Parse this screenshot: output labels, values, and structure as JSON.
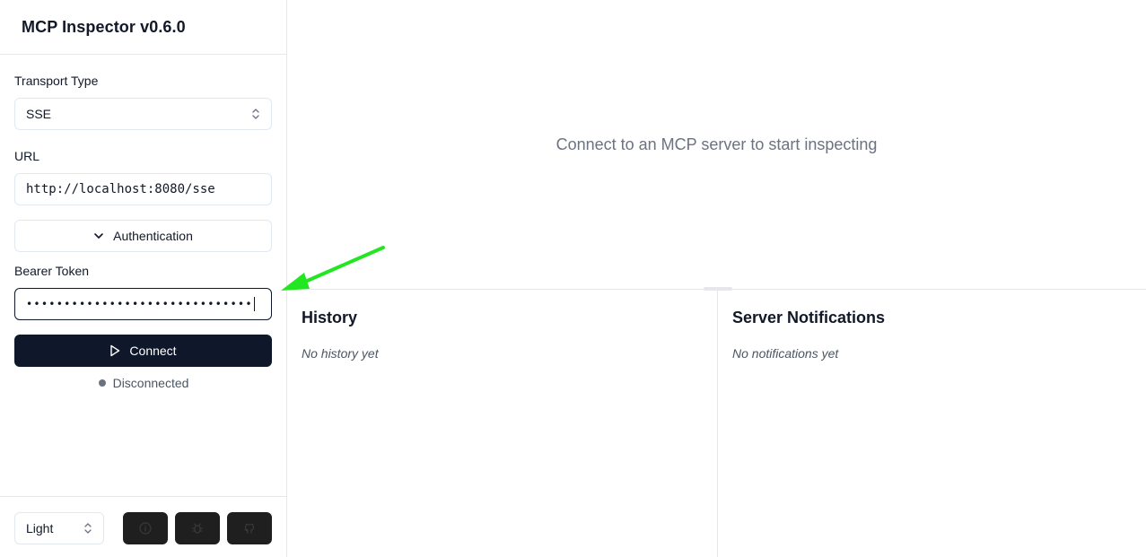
{
  "app": {
    "title": "MCP Inspector v0.6.0"
  },
  "sidebar": {
    "transport": {
      "label": "Transport Type",
      "value": "SSE"
    },
    "url": {
      "label": "URL",
      "value": "http://localhost:8080/sse"
    },
    "auth": {
      "label": "Authentication"
    },
    "bearer": {
      "label": "Bearer Token",
      "masked_value": "••••••••••••••••••••••••••••••"
    },
    "connect": {
      "label": "Connect"
    },
    "status": {
      "text": "Disconnected",
      "color": "#6b7280"
    },
    "footer": {
      "theme": {
        "value": "Light"
      },
      "buttons": [
        {
          "icon": "info-icon"
        },
        {
          "icon": "bug-icon"
        },
        {
          "icon": "github-icon"
        }
      ]
    }
  },
  "main": {
    "empty_message": "Connect to an MCP server to start inspecting",
    "history": {
      "title": "History",
      "empty": "No history yet"
    },
    "notifications": {
      "title": "Server Notifications",
      "empty": "No notifications yet"
    }
  },
  "annotation": {
    "arrow_color": "#22e622"
  },
  "colors": {
    "primary": "#0f172a",
    "border": "#e2e8f0",
    "muted_text": "#6b7280"
  }
}
